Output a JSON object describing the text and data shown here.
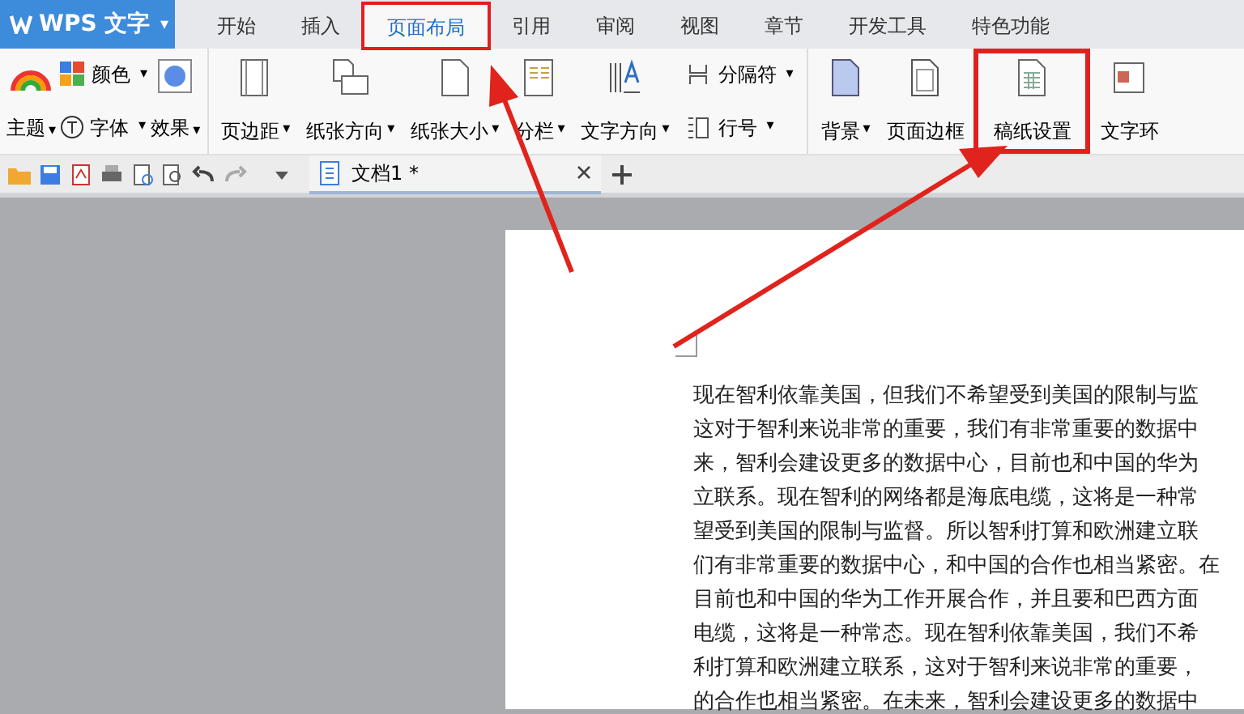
{
  "app": {
    "title": "WPS 文字",
    "menu_caret": "▾"
  },
  "tabs": [
    {
      "label": "开始",
      "selected": false
    },
    {
      "label": "插入",
      "selected": false
    },
    {
      "label": "页面布局",
      "selected": true
    },
    {
      "label": "引用",
      "selected": false
    },
    {
      "label": "审阅",
      "selected": false
    },
    {
      "label": "视图",
      "selected": false
    },
    {
      "label": "章节",
      "selected": false
    },
    {
      "label": "开发工具",
      "selected": false
    },
    {
      "label": "特色功能",
      "selected": false
    }
  ],
  "ribbon": {
    "groups": [
      {
        "items": [
          {
            "kind": "theme",
            "label": "主题",
            "dropdown": true
          },
          {
            "kind": "color",
            "label": "颜色",
            "dropdown": true
          },
          {
            "kind": "font",
            "label": "字体",
            "dropdown": true
          },
          {
            "kind": "effect",
            "label": "效果",
            "dropdown": true
          }
        ]
      },
      {
        "items": [
          {
            "kind": "large",
            "label": "页边距",
            "dropdown": true
          },
          {
            "kind": "large",
            "label": "纸张方向",
            "dropdown": true
          },
          {
            "kind": "large",
            "label": "纸张大小",
            "dropdown": true
          },
          {
            "kind": "large",
            "label": "分栏",
            "dropdown": true
          },
          {
            "kind": "large",
            "label": "文字方向",
            "dropdown": true
          },
          {
            "kind": "pair",
            "items": [
              {
                "label": "分隔符",
                "dropdown": true
              },
              {
                "label": "行号",
                "dropdown": true
              }
            ]
          }
        ]
      },
      {
        "items": [
          {
            "kind": "large",
            "label": "背景",
            "dropdown": true
          },
          {
            "kind": "large",
            "label": "页面边框",
            "dropdown": false
          },
          {
            "kind": "large",
            "label": "稿纸设置",
            "dropdown": false,
            "highlighted": true
          },
          {
            "kind": "large",
            "label": "文字环",
            "dropdown": false
          }
        ]
      }
    ]
  },
  "document_tab": {
    "title": "文档1 *"
  },
  "document": {
    "lines": [
      "现在智利依靠美国，但我们不希望受到美国的限制与监",
      "这对于智利来说非常的重要，我们有非常重要的数据中",
      "来，智利会建设更多的数据中心，目前也和中国的华为",
      "立联系。现在智利的网络都是海底电缆，这将是一种常",
      "望受到美国的限制与监督。所以智利打算和欧洲建立联",
      "们有非常重要的数据中心，和中国的合作也相当紧密。在",
      "目前也和中国的华为工作开展合作，并且要和巴西方面",
      "电缆，这将是一种常态。现在智利依靠美国，我们不希",
      "利打算和欧洲建立联系，这对于智利来说非常的重要，",
      "的合作也相当紧密。在未来，智利会建设更多的数据中"
    ]
  }
}
